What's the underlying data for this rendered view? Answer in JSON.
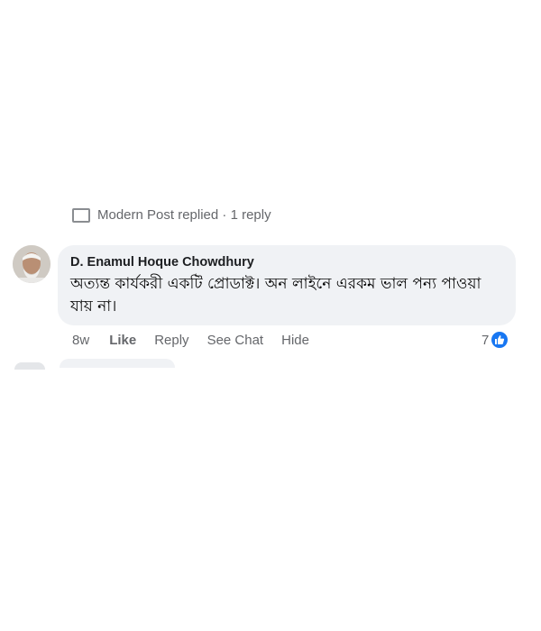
{
  "previous_comment_row": {
    "text": "Modern Post replied · 1 reply"
  },
  "comment": {
    "author": "D. Enamul Hoque Chowdhury",
    "text": "অত্যন্ত কার্যকরী একটি প্রোডাক্ট। অন লাইনে এরকম ভাল পন্য পাওয়া যায় না।",
    "time": "8w",
    "actions": {
      "like": "Like",
      "reply": "Reply",
      "see_chat": "See Chat",
      "hide": "Hide"
    },
    "reaction_count": "7",
    "reaction_icon": "thumbs-up-icon"
  },
  "colors": {
    "bubble_bg": "#f0f2f5",
    "meta_text": "#65676b",
    "like_blue": "#1877f2"
  }
}
